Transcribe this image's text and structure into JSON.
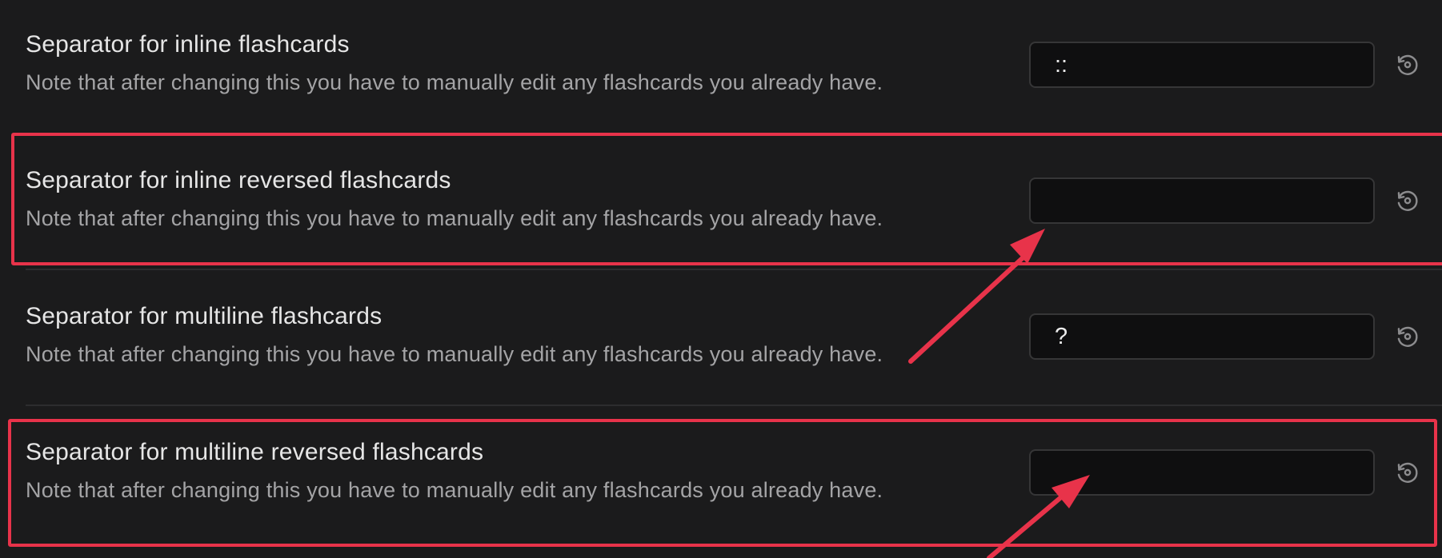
{
  "settings": [
    {
      "title": "Separator for inline flashcards",
      "description": "Note that after changing this you have to manually edit any flashcards you already have.",
      "value": "::"
    },
    {
      "title": "Separator for inline reversed flashcards",
      "description": "Note that after changing this you have to manually edit any flashcards you already have.",
      "value": ""
    },
    {
      "title": "Separator for multiline flashcards",
      "description": "Note that after changing this you have to manually edit any flashcards you already have.",
      "value": "?"
    },
    {
      "title": "Separator for multiline reversed flashcards",
      "description": "Note that after changing this you have to manually edit any flashcards you already have.",
      "value": ""
    }
  ],
  "icons": {
    "reset": "reset-icon",
    "annotation_arrow": "arrow-icon"
  },
  "colors": {
    "background": "#1b1b1c",
    "input_background": "#0f0f10",
    "annotation": "#e8334a",
    "title_text": "#e6e6e6",
    "description_text": "#a4a4a6"
  }
}
